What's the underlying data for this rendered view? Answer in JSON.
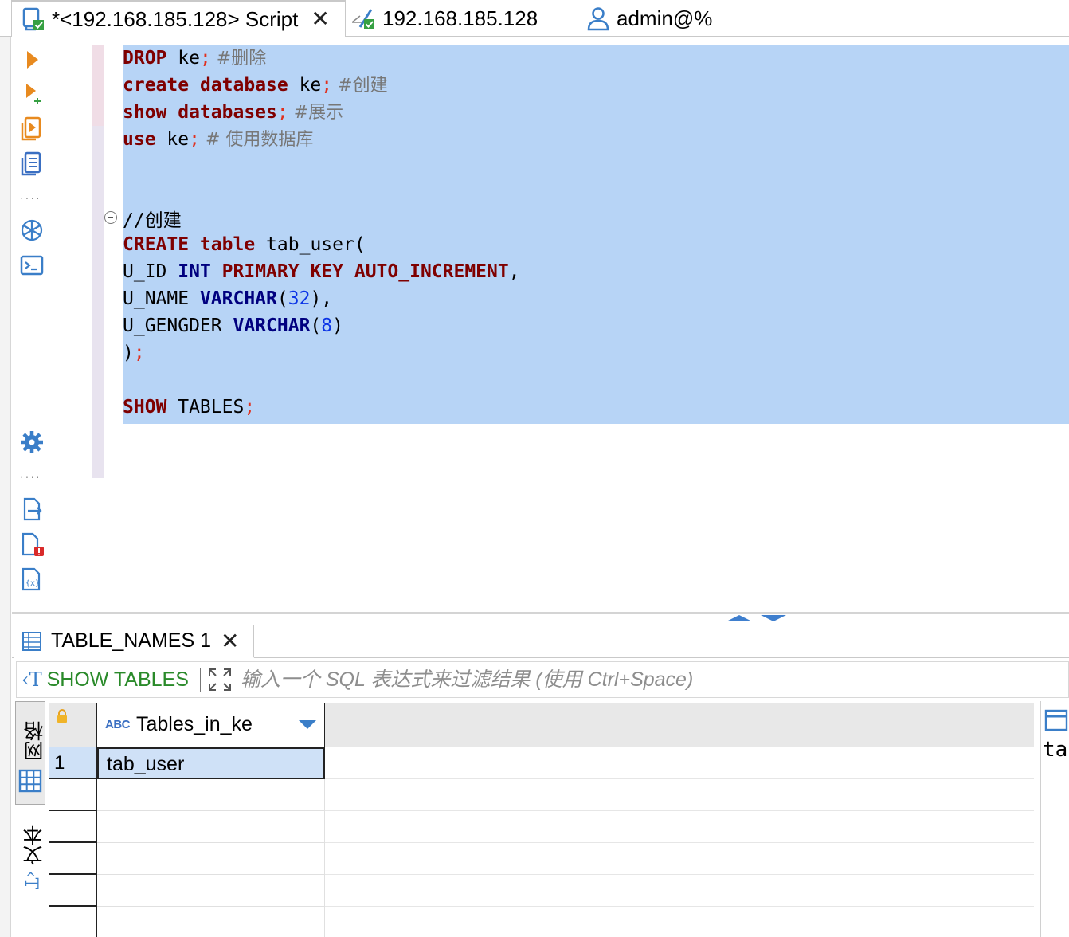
{
  "tabs": {
    "script_tab": "*<192.168.185.128> Script",
    "connection_tab": "192.168.185.128",
    "user_tab": "admin@%"
  },
  "toolbar": {
    "icons": [
      "execute-statement-icon",
      "execute-script-icon",
      "explain-plan-icon",
      "load-plan-icon",
      "ai-assistant-icon",
      "terminal-icon",
      "settings-icon",
      "export-icon",
      "error-log-icon",
      "variables-icon"
    ]
  },
  "editor": {
    "lines": [
      {
        "parts": [
          {
            "t": "DROP",
            "c": "kw"
          },
          {
            "t": " ke"
          },
          {
            "t": ";",
            "c": "sc"
          },
          {
            "t": " #删除",
            "c": "cm"
          }
        ]
      },
      {
        "parts": [
          {
            "t": "create",
            "c": "kw"
          },
          {
            "t": " "
          },
          {
            "t": "database",
            "c": "kw"
          },
          {
            "t": " ke"
          },
          {
            "t": ";",
            "c": "sc"
          },
          {
            "t": " #创建",
            "c": "cm"
          }
        ]
      },
      {
        "parts": [
          {
            "t": "show",
            "c": "kw"
          },
          {
            "t": " "
          },
          {
            "t": "databases",
            "c": "kw"
          },
          {
            "t": ";",
            "c": "sc"
          },
          {
            "t": " #展示",
            "c": "cm"
          }
        ]
      },
      {
        "parts": [
          {
            "t": "use",
            "c": "kw"
          },
          {
            "t": " ke"
          },
          {
            "t": ";",
            "c": "sc"
          },
          {
            "t": " # 使用数据库",
            "c": "cm"
          }
        ]
      },
      {
        "parts": []
      },
      {
        "parts": []
      },
      {
        "parts": [
          {
            "t": "//创建"
          }
        ]
      },
      {
        "parts": [
          {
            "t": "CREATE",
            "c": "kw"
          },
          {
            "t": " "
          },
          {
            "t": "table",
            "c": "kw"
          },
          {
            "t": " tab_user("
          }
        ]
      },
      {
        "parts": [
          {
            "t": "U_ID "
          },
          {
            "t": "INT",
            "c": "ty"
          },
          {
            "t": " "
          },
          {
            "t": "PRIMARY",
            "c": "kw"
          },
          {
            "t": " "
          },
          {
            "t": "KEY",
            "c": "kw"
          },
          {
            "t": " "
          },
          {
            "t": "AUTO_INCREMENT",
            "c": "kw"
          },
          {
            "t": ","
          }
        ]
      },
      {
        "parts": [
          {
            "t": "U_NAME "
          },
          {
            "t": "VARCHAR",
            "c": "ty"
          },
          {
            "t": "("
          },
          {
            "t": "32",
            "c": "num"
          },
          {
            "t": "),"
          }
        ]
      },
      {
        "parts": [
          {
            "t": "U_GENGDER "
          },
          {
            "t": "VARCHAR",
            "c": "ty"
          },
          {
            "t": "("
          },
          {
            "t": "8",
            "c": "num"
          },
          {
            "t": ")"
          }
        ]
      },
      {
        "parts": [
          {
            "t": ")"
          },
          {
            "t": ";",
            "c": "sc"
          }
        ]
      },
      {
        "parts": []
      },
      {
        "parts": [
          {
            "t": "SHOW",
            "c": "kw"
          },
          {
            "t": " TABLES"
          },
          {
            "t": ";",
            "c": "sc"
          }
        ]
      }
    ]
  },
  "results": {
    "tab_label": "TABLE_NAMES 1",
    "query_label": "SHOW TABLES",
    "filter_placeholder": "输入一个 SQL 表达式来过滤结果 (使用 Ctrl+Space)",
    "mode_grid": "网格",
    "mode_text": "文本",
    "column": "Tables_in_ke",
    "rows": [
      {
        "num": "1",
        "value": "tab_user"
      }
    ],
    "side_panel_text": "tab"
  },
  "colors": {
    "selection": "#b7d4f6",
    "keyword": "#7f0000",
    "type": "#00007f",
    "number": "#0b34e6",
    "accent": "#3a7ec8"
  }
}
